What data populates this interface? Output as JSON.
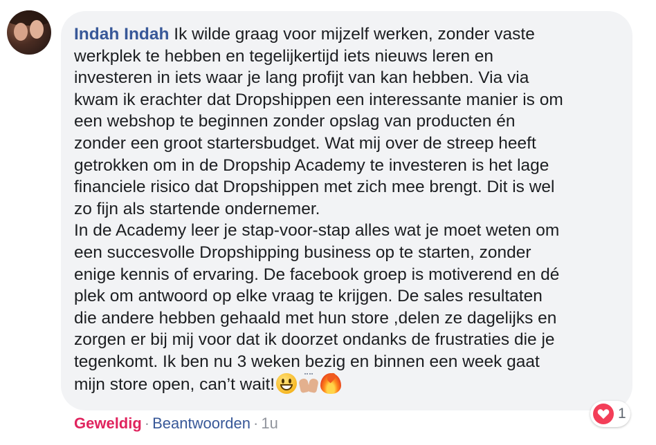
{
  "comment": {
    "author": "Indah Indah",
    "text": "Ik wilde graag voor mijzelf werken, zonder vaste\nwerkplek te hebben en tegelijkertijd iets nieuws leren en\ninvesteren in iets waar je lang profijt van kan hebben. Via via\nkwam ik erachter dat Dropshippen een interessante manier is om\neen webshop te beginnen zonder opslag van producten én\nzonder een groot startersbudget. Wat mij over de streep heeft\ngetrokken om in de Dropship Academy te investeren is het lage\nfinanciele risico dat Dropshippen met zich mee brengt. Dit is wel\nzo fijn als startende ondernemer.\nIn de Academy leer je stap-voor-stap alles wat je moet weten om\neen succesvolle Dropshipping business op te starten, zonder\nenige kennis of ervaring. De facebook groep is motiverend en dé\nplek om antwoord op elke vraag te krijgen. De sales resultaten\ndie andere hebben gehaald met hun store ,delen ze dagelijks en\nzorgen er bij mij voor dat ik doorzet ondanks de frustraties die je\ntegenkomt. Ik ben nu 3 weken bezig en binnen een week gaat\nmijn store open, can’t wait!",
    "emojis": [
      "grinning-face-icon",
      "raising-hands-icon",
      "fire-icon"
    ]
  },
  "reactions": {
    "type": "heart-icon",
    "count": "1",
    "color": "#f33e58"
  },
  "actions": {
    "react_label": "Geweldig",
    "separator": "·",
    "reply_label": "Beantwoorden",
    "time": "1u"
  },
  "colors": {
    "bubble": "#f2f3f5",
    "author": "#385898",
    "text": "#1c1e21",
    "react": "#e0245e",
    "meta": "#90949c"
  }
}
